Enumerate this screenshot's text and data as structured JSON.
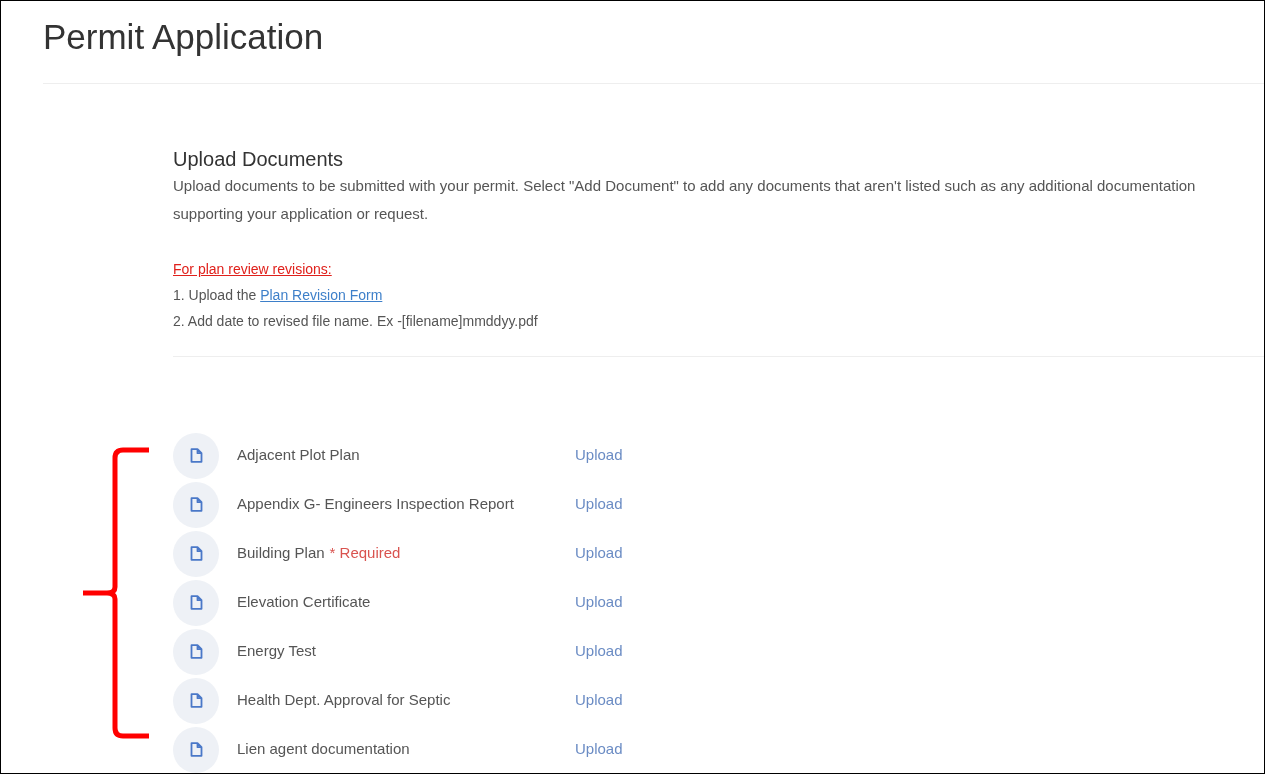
{
  "page": {
    "title": "Permit Application"
  },
  "section": {
    "title": "Upload Documents",
    "description": "Upload documents to be submitted with your permit. Select \"Add Document\" to add any documents that aren't listed such as any additional documentation supporting your application or request.",
    "revisions_heading": "For plan review revisions:",
    "steps": [
      {
        "text": "1. Upload the ",
        "link": "Plan Revision Form"
      },
      {
        "text": "2. Add date to revised file name. Ex -[filename]mmddyy.pdf"
      }
    ]
  },
  "documents": [
    {
      "name": "Adjacent Plot Plan",
      "action": "Upload"
    },
    {
      "name": "Appendix G- Engineers Inspection Report",
      "action": "Upload"
    },
    {
      "name": "Building Plan",
      "note": "* Required",
      "action": "Upload"
    },
    {
      "name": "Elevation Certificate",
      "action": "Upload"
    },
    {
      "name": "Energy Test",
      "action": "Upload"
    },
    {
      "name": "Health Dept. Approval for Septic",
      "action": "Upload"
    },
    {
      "name": "Lien agent documentation",
      "action": "Upload"
    }
  ]
}
